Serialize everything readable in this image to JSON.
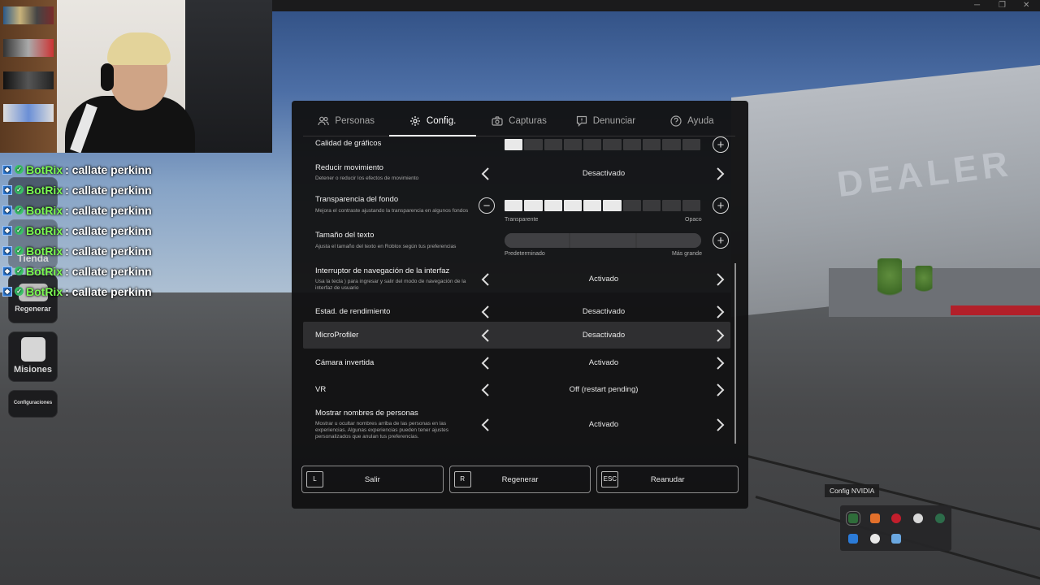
{
  "menu": {
    "tabs": [
      {
        "label": "Personas",
        "icon": "people-icon",
        "active": false
      },
      {
        "label": "Config.",
        "icon": "gear-icon",
        "active": true
      },
      {
        "label": "Capturas",
        "icon": "camera-icon",
        "active": false
      },
      {
        "label": "Denunciar",
        "icon": "report-icon",
        "active": false
      },
      {
        "label": "Ayuda",
        "icon": "help-icon",
        "active": false
      }
    ],
    "settings": [
      {
        "title": "Calidad de gráficos",
        "desc": "",
        "level": 1,
        "segments": 10
      },
      {
        "title": "Reducir movimiento",
        "desc": "Detener o reducir los efectos de movimiento",
        "value": "Desactivado"
      },
      {
        "title": "Transparencia del fondo",
        "desc": "Mejora el contraste ajustando la transparencia en algunos fondos",
        "level": 6,
        "segments": 10,
        "min_label": "Transparente",
        "max_label": "Opaco"
      },
      {
        "title": "Tamaño del texto",
        "desc": "Ajusta el tamaño del texto en Roblox según tus preferencias",
        "min_label": "Predeterminado",
        "max_label": "Más grande"
      },
      {
        "title": "Interruptor de navegación de la interfaz",
        "desc": "Usa la tecla ) para ingresar y salir del modo de navegación de la interfaz de usuario",
        "value": "Activado"
      },
      {
        "title": "Estad. de rendimiento",
        "desc": "",
        "value": "Desactivado"
      },
      {
        "title": "MicroProfiler",
        "desc": "",
        "value": "Desactivado"
      },
      {
        "title": "Cámara invertida",
        "desc": "",
        "value": "Activado"
      },
      {
        "title": "VR",
        "desc": "",
        "value": "Off (restart pending)"
      },
      {
        "title": "Mostrar nombres de personas",
        "desc": "Mostrar u ocultar nombres arriba de las personas en las experiencias. Algunas experiencias pueden tener ajustes personalizados que anulan tus preferencias.",
        "value": "Activado"
      }
    ],
    "footer": [
      {
        "key": "L",
        "label": "Salir"
      },
      {
        "key": "R",
        "label": "Regenerar"
      },
      {
        "key": "ESC",
        "label": "Reanudar"
      }
    ]
  },
  "chat": {
    "user": "BotRix",
    "messages": [
      ": callate perkinn",
      ": callate perkinn",
      ": callate perkinn",
      ": callate perkinn",
      ": callate perkinn",
      ": callate perkinn",
      ": callate perkinn"
    ],
    "user_color": "#7cfc52"
  },
  "side_buttons": {
    "tienda": "Tienda",
    "regenerar": "Regenerar",
    "misiones": "Misiones",
    "configuraciones": "Configuraciones"
  },
  "scene": {
    "building_sign": "DEALER"
  },
  "tray": {
    "tooltip": "Config NVIDIA"
  }
}
